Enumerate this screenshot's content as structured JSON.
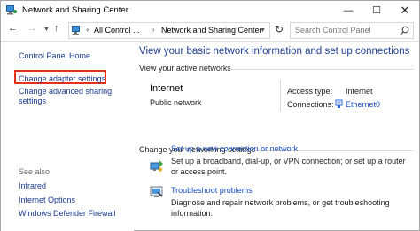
{
  "window": {
    "title": "Network and Sharing Center",
    "controls": {
      "minimize": "—",
      "maximize": "☐",
      "close": "✕"
    }
  },
  "address": {
    "prefix": "«",
    "crumbs": [
      "All Control ...",
      "Network and Sharing Center"
    ],
    "separator": "›",
    "search_placeholder": "Search Control Panel"
  },
  "sidebar": {
    "home": "Control Panel Home",
    "items": [
      "Change adapter settings",
      "Change advanced sharing settings"
    ],
    "see_also_label": "See also",
    "see_also": [
      "Infrared",
      "Internet Options",
      "Windows Defender Firewall"
    ]
  },
  "main": {
    "title": "View your basic network information and set up connections",
    "active_networks_label": "View your active networks",
    "network": {
      "name": "Internet",
      "category": "Public network",
      "access_type_label": "Access type:",
      "access_type": "Internet",
      "connections_label": "Connections:",
      "connection": "Ethernet0"
    },
    "settings_label": "Change your networking settings",
    "tasks": [
      {
        "link": "Set up a new connection or network",
        "description": "Set up a broadband, dial-up, or VPN connection; or set up a router or access point."
      },
      {
        "link": "Troubleshoot problems",
        "description": "Diagnose and repair network problems, or get troubleshooting information."
      }
    ]
  },
  "colors": {
    "link": "#1a4fc2",
    "heading": "#1e3d8f",
    "highlight": "#e3311a"
  }
}
